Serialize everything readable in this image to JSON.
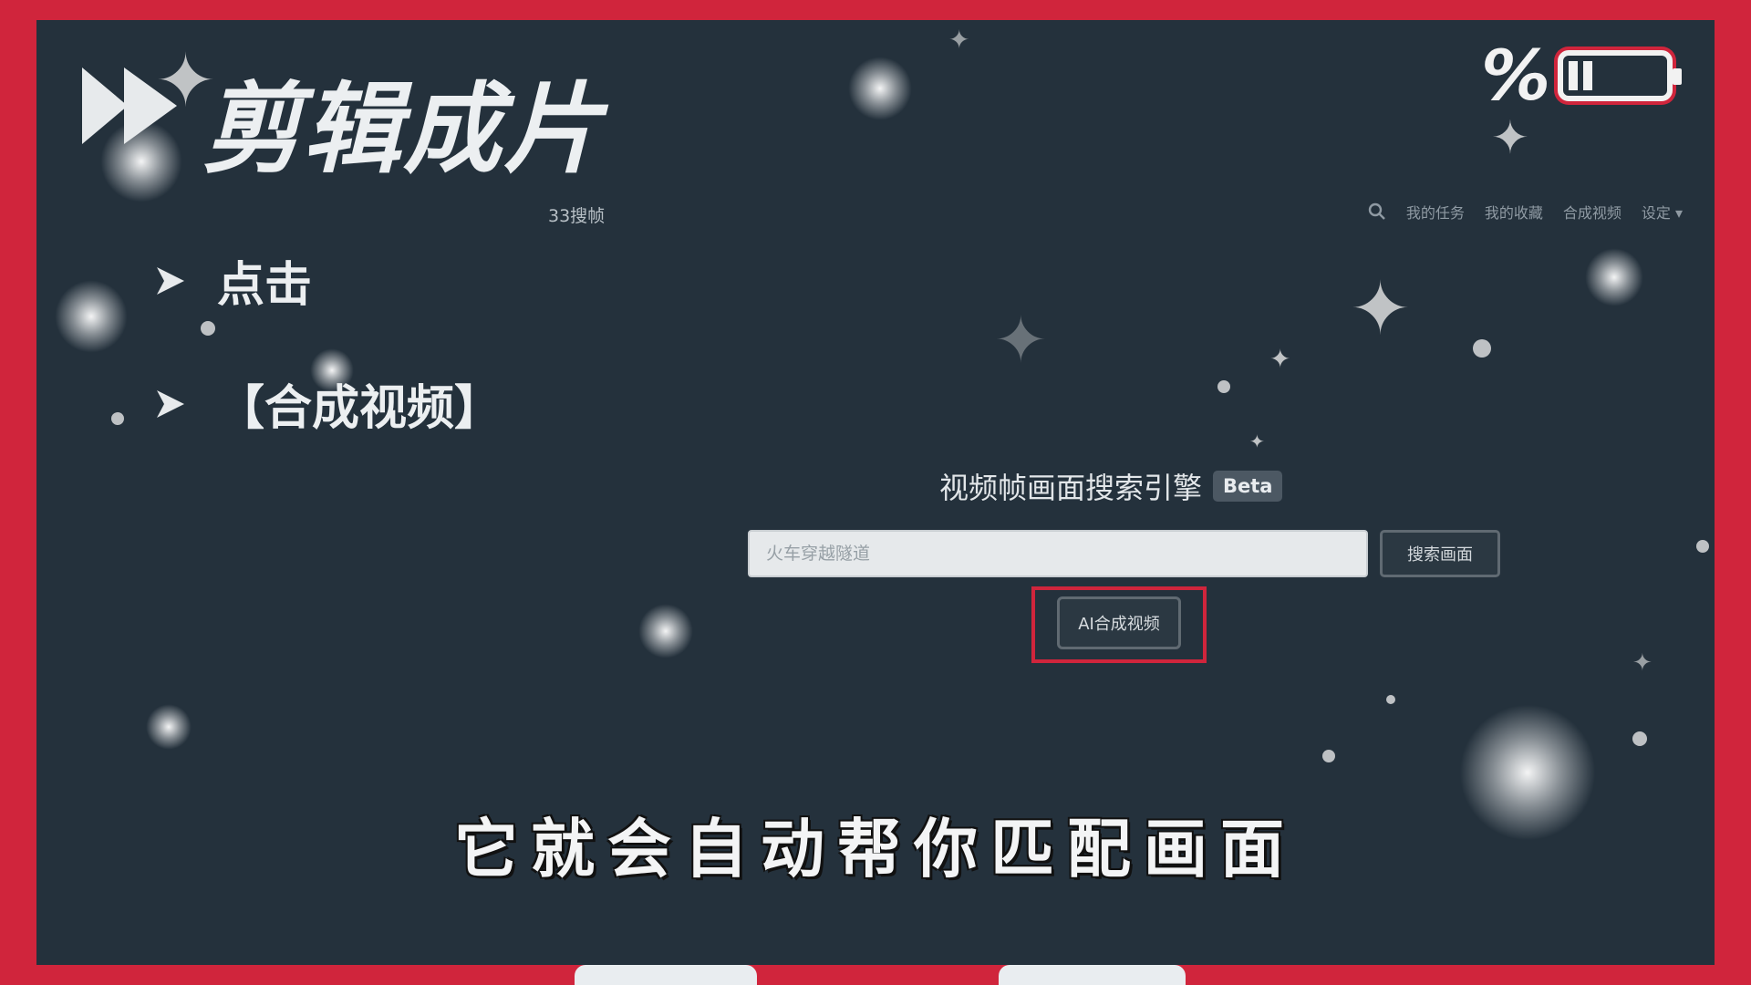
{
  "video": {
    "title": "剪辑成片",
    "bullets": [
      "点击",
      "【合成视频】"
    ],
    "caption": "它就会自动帮你匹配画面",
    "battery_symbol": "%",
    "battery_level": 0.4
  },
  "screenshot": {
    "brand": "33搜帧",
    "nav": {
      "icon": "search-icon",
      "items": [
        "我的任务",
        "我的收藏",
        "合成视频",
        "设定"
      ]
    },
    "engine": {
      "title": "视频帧画面搜索引擎",
      "badge": "Beta"
    },
    "search": {
      "placeholder": "火车穿越隧道",
      "button_label": "搜索画面"
    },
    "ai_button_label": "AI合成视频"
  },
  "colors": {
    "frame_red": "#d0253c",
    "background": "#24313c"
  }
}
